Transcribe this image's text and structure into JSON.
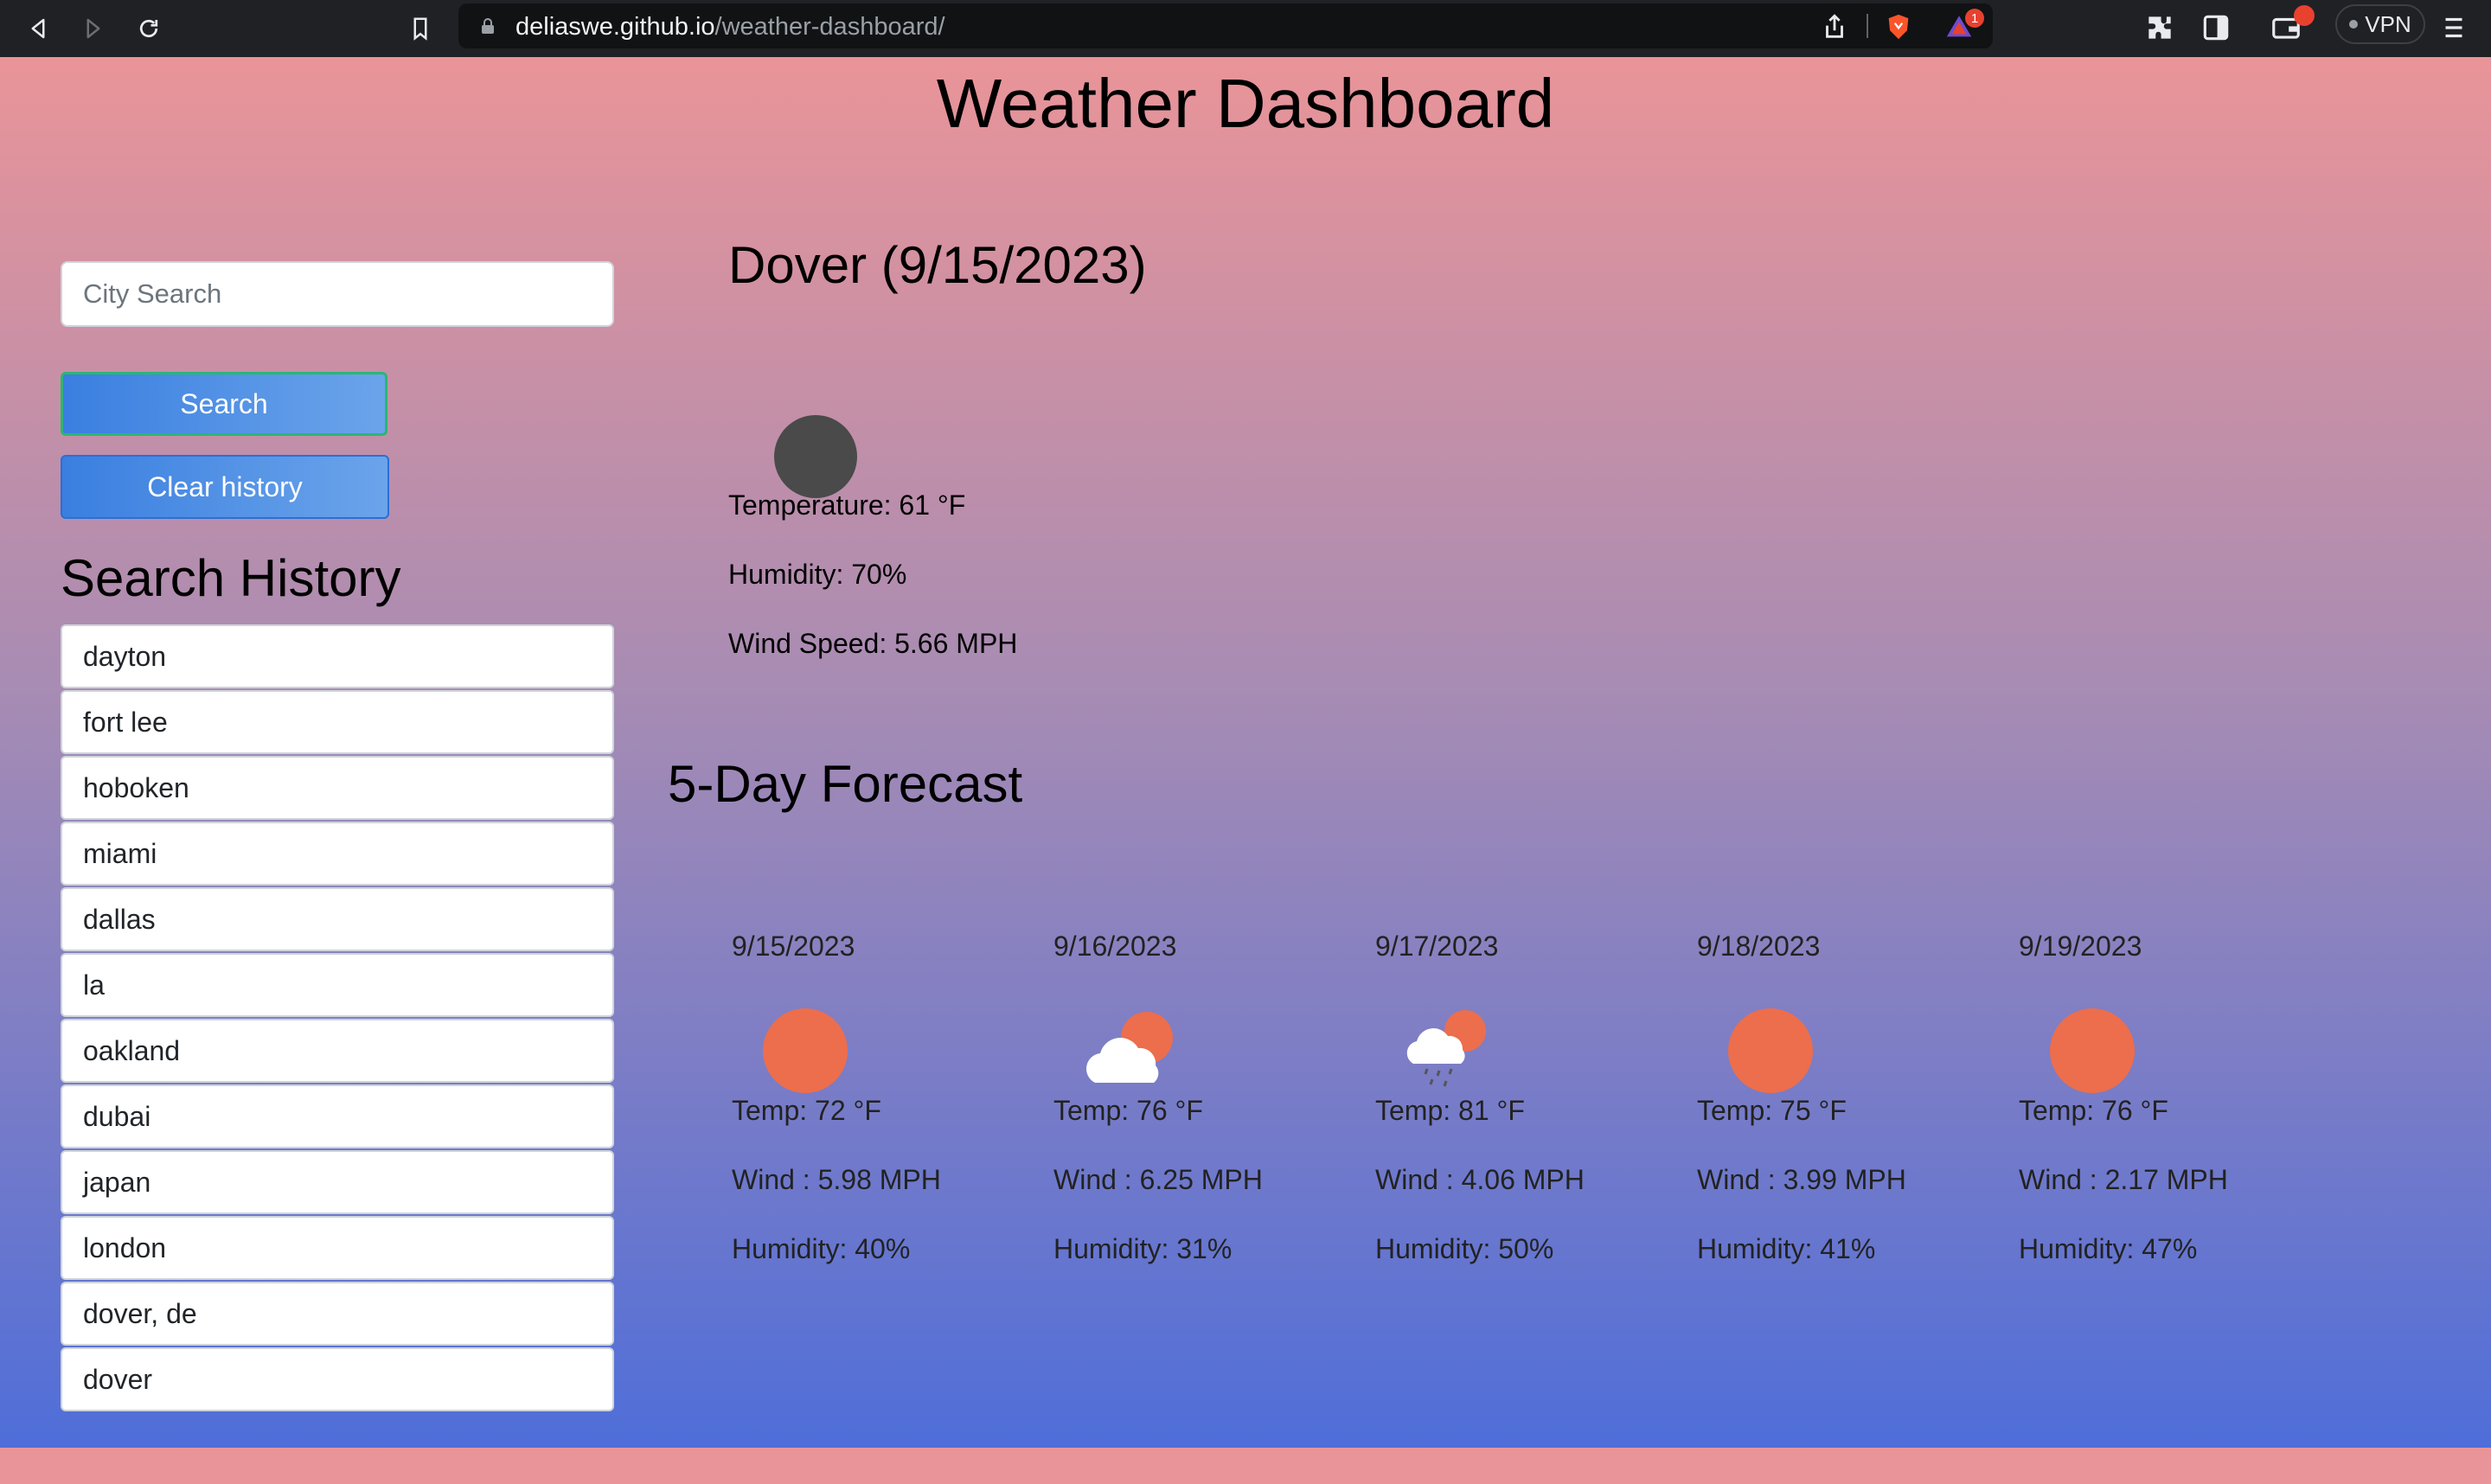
{
  "browser": {
    "url_host": "deliaswe.github.io",
    "url_path": "/weather-dashboard/",
    "vpn_label": "VPN",
    "alert_count": "1"
  },
  "app": {
    "title": "Weather Dashboard"
  },
  "search": {
    "placeholder": "City Search",
    "search_label": "Search",
    "clear_label": "Clear history"
  },
  "history": {
    "title": "Search History",
    "items": [
      "dayton",
      "fort lee",
      "hoboken",
      "miami",
      "dallas",
      "la",
      "oakland",
      "dubai",
      "japan",
      "london",
      "dover, de",
      "dover"
    ]
  },
  "current": {
    "title": "Dover (9/15/2023)",
    "icon": "dark-moon-icon",
    "temperature": "Temperature: 61 °F",
    "humidity": "Humidity: 70%",
    "wind": "Wind Speed: 5.66 MPH"
  },
  "forecast": {
    "title": "5-Day Forecast",
    "days": [
      {
        "date": "9/15/2023",
        "icon": "sun-icon",
        "temp": "Temp: 72 °F",
        "wind": "Wind : 5.98 MPH",
        "humidity": "Humidity: 40%"
      },
      {
        "date": "9/16/2023",
        "icon": "cloud-sun-icon",
        "temp": "Temp: 76 °F",
        "wind": "Wind : 6.25 MPH",
        "humidity": "Humidity: 31%"
      },
      {
        "date": "9/17/2023",
        "icon": "rain-cloud-sun-icon",
        "temp": "Temp: 81 °F",
        "wind": "Wind : 4.06 MPH",
        "humidity": "Humidity: 50%"
      },
      {
        "date": "9/18/2023",
        "icon": "sun-icon",
        "temp": "Temp: 75 °F",
        "wind": "Wind : 3.99 MPH",
        "humidity": "Humidity: 41%"
      },
      {
        "date": "9/19/2023",
        "icon": "sun-icon",
        "temp": "Temp: 76 °F",
        "wind": "Wind : 2.17 MPH",
        "humidity": "Humidity: 47%"
      }
    ]
  },
  "colors": {
    "sun": "#ec6e4c",
    "moon": "#4a4a4a",
    "cloud": "#ffffff",
    "rain": "#555555",
    "gradient_top": "#e99498",
    "gradient_bottom": "#4f6ed9",
    "button_blue": "#3a7fe0"
  }
}
